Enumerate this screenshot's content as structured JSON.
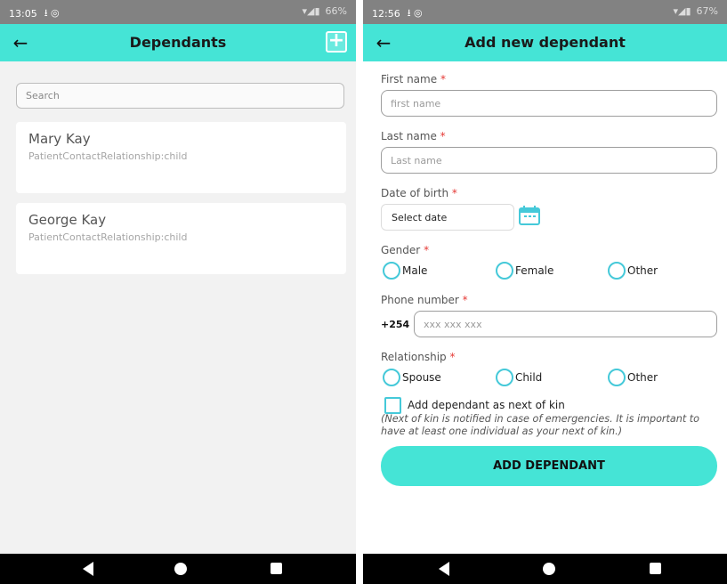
{
  "left_screen": {
    "status_bar": {
      "time": "13:05",
      "left_icons": "⭳ ◎",
      "right_icons": "▾◢▮",
      "battery": "66%"
    },
    "app_bar": {
      "title": "Dependants",
      "back_icon": "arrow-left-icon",
      "add_icon": "plus-icon"
    },
    "search": {
      "placeholder": "Search"
    },
    "dependants": [
      {
        "name": "Mary Kay",
        "relationship": "PatientContactRelationship:child"
      },
      {
        "name": "George Kay",
        "relationship": "PatientContactRelationship:child"
      }
    ]
  },
  "right_screen": {
    "status_bar": {
      "time": "12:56",
      "left_icons": "⭳ ◎",
      "right_icons": "▾◢▮",
      "battery": "67%"
    },
    "app_bar": {
      "title": "Add new dependant",
      "back_icon": "arrow-left-icon"
    },
    "form": {
      "required_mark": "*",
      "first_name": {
        "label": "First name",
        "placeholder": "first name"
      },
      "last_name": {
        "label": "Last name",
        "placeholder": "Last name"
      },
      "dob": {
        "label": "Date of birth",
        "value": "Select date"
      },
      "gender": {
        "label": "Gender",
        "options": [
          "Male",
          "Female",
          "Other"
        ]
      },
      "phone": {
        "label": "Phone number",
        "prefix": "+254",
        "placeholder": "xxx xxx xxx"
      },
      "relationship": {
        "label": "Relationship",
        "options": [
          "Spouse",
          "Child",
          "Other"
        ]
      },
      "next_of_kin": {
        "label": "Add dependant as next of kin",
        "note": "(Next of kin is notified in case of emergencies. It is important to have at least one individual as your next of kin.)"
      },
      "submit_label": "ADD DEPENDANT"
    }
  },
  "colors": {
    "accent": "#45e4d6",
    "status_bar": "#828282",
    "radio_border": "#45c9d9",
    "required": "#e53935"
  }
}
